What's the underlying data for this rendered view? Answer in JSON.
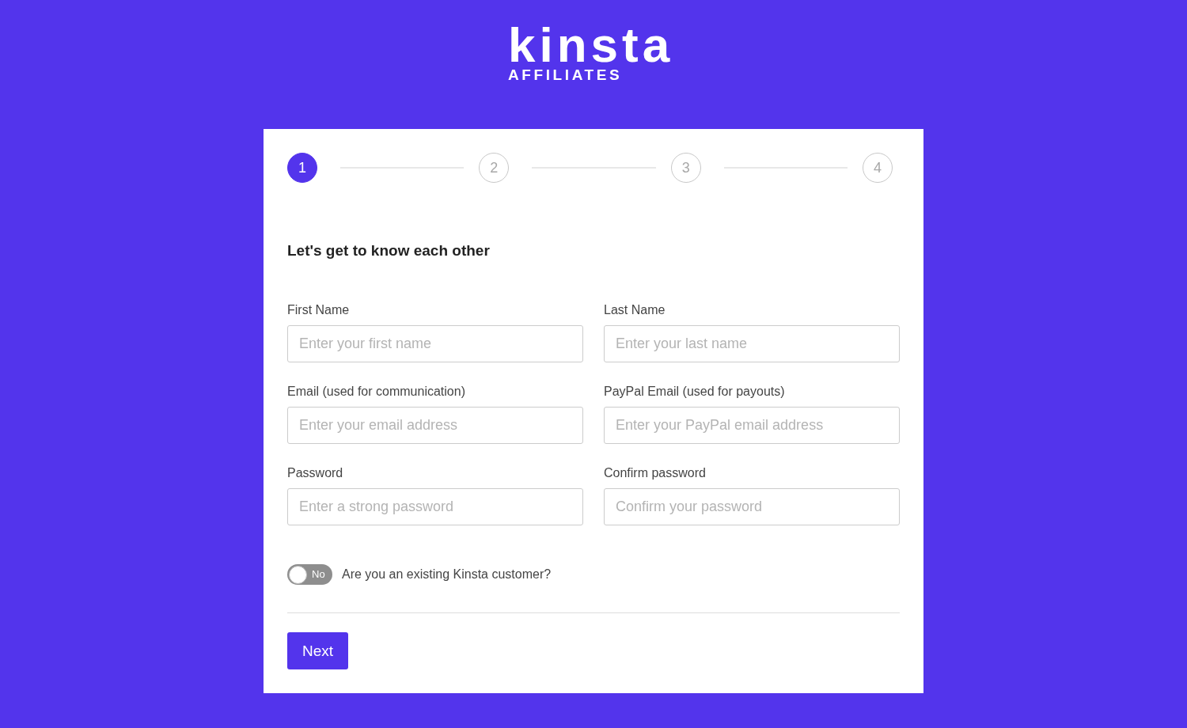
{
  "logo": {
    "wordmark": "kinsta",
    "subtitle": "AFFILIATES"
  },
  "stepper": {
    "steps": [
      {
        "label": "1",
        "active": true
      },
      {
        "label": "2",
        "active": false
      },
      {
        "label": "3",
        "active": false
      },
      {
        "label": "4",
        "active": false
      }
    ]
  },
  "form": {
    "heading": "Let's get to know each other",
    "fields": [
      {
        "label": "First Name",
        "placeholder": "Enter your first name"
      },
      {
        "label": "Last Name",
        "placeholder": "Enter your last name"
      },
      {
        "label": "Email (used for communication)",
        "placeholder": "Enter your email address"
      },
      {
        "label": "PayPal Email (used for payouts)",
        "placeholder": "Enter your PayPal email address"
      },
      {
        "label": "Password",
        "placeholder": "Enter a strong password"
      },
      {
        "label": "Confirm password",
        "placeholder": "Confirm your password"
      }
    ],
    "toggle": {
      "on": false,
      "text": "No",
      "label": "Are you an existing Kinsta customer?"
    },
    "buttons": [
      {
        "label": "Next"
      }
    ]
  }
}
